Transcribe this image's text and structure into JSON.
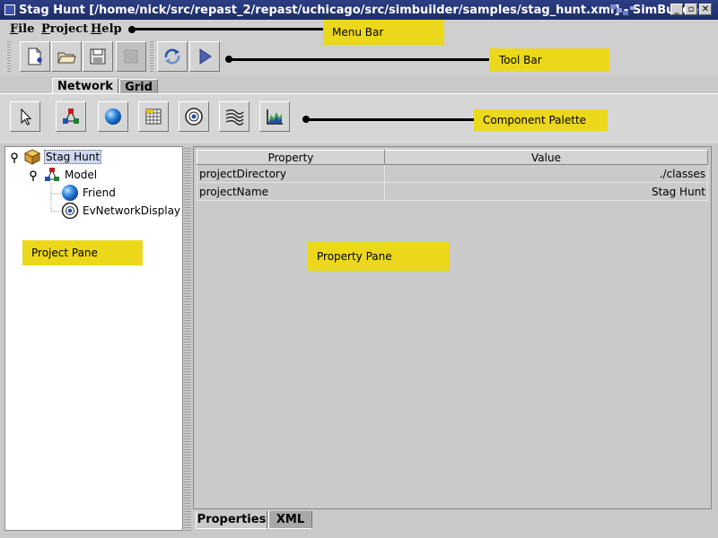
{
  "window": {
    "title": "Stag Hunt [/home/nick/src/repast_2/repast/uchicago/src/simbuilder/samples/stag_hunt.xml] - SimBuilder",
    "buttons": [
      "minimize",
      "maximize",
      "close"
    ]
  },
  "menubar": {
    "items": [
      {
        "label": "File",
        "mnemonic": "F",
        "rest": "ile"
      },
      {
        "label": "Project",
        "mnemonic": "P",
        "rest": "roject"
      },
      {
        "label": "Help",
        "mnemonic": "H",
        "rest": "elp"
      }
    ]
  },
  "toolbar": {
    "buttons": [
      "new-project-icon",
      "open-folder-icon",
      "save-disk-icon",
      "disabled-icon",
      "refresh-icon",
      "run-play-icon"
    ]
  },
  "palette": {
    "tabs": [
      "Network",
      "Grid"
    ],
    "selected_tab": "Network",
    "buttons": [
      "select-arrow-icon",
      "model-network-icon",
      "agent-sphere-icon",
      "grid-space-icon",
      "display-target-icon",
      "schedule-icon",
      "chart-icon"
    ]
  },
  "annotations": {
    "menu_bar": "Menu Bar",
    "tool_bar": "Tool Bar",
    "component_palette": "Component Palette",
    "project_pane": "Project Pane",
    "property_pane": "Property Pane"
  },
  "project_tree": {
    "root": "Stag Hunt",
    "model": "Model",
    "children": [
      "Friend",
      "EvNetworkDisplay"
    ]
  },
  "property_table": {
    "headers": [
      "Property",
      "Value"
    ],
    "rows": [
      {
        "property": "projectDirectory",
        "value": "./classes"
      },
      {
        "property": "projectName",
        "value": "Stag Hunt"
      }
    ]
  },
  "bottom_tabs": {
    "items": [
      "Properties",
      "XML"
    ],
    "selected": "Properties"
  },
  "colors": {
    "title_bar": "#1d2c6a",
    "annotation": "#ecd81a",
    "selection": "#cfd8f2"
  }
}
